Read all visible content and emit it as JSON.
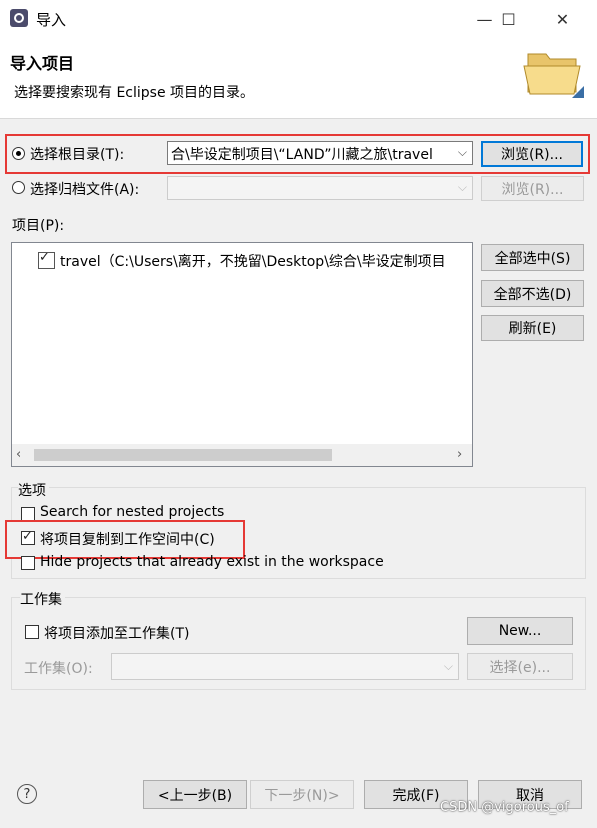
{
  "window": {
    "title": "导入",
    "controls": {
      "minimize": "—",
      "maximize": "☐",
      "close": "✕"
    }
  },
  "header": {
    "title": "导入项目",
    "subtitle": "选择要搜索现有 Eclipse 项目的目录。"
  },
  "source": {
    "root_dir_label": "选择根目录(T):",
    "root_dir_selected": true,
    "root_dir_value": "合\\毕设定制项目\\“LAND”川藏之旅\\travel",
    "root_browse_label": "浏览(R)...",
    "archive_label": "选择归档文件(A):",
    "archive_selected": false,
    "archive_value": "",
    "archive_browse_label": "浏览(R)..."
  },
  "projects": {
    "label": "项目(P):",
    "items": [
      {
        "checked": true,
        "text": "travel（C:\\Users\\离开，不挽留\\Desktop\\综合\\毕设定制项目"
      }
    ],
    "buttons": {
      "select_all": "全部选中(S)",
      "deselect_all": "全部不选(D)",
      "refresh": "刷新(E)"
    }
  },
  "options": {
    "group_label": "选项",
    "search_nested": {
      "label": "Search for nested projects",
      "checked": false
    },
    "copy_into_workspace": {
      "label": "将项目复制到工作空间中(C)",
      "checked": true
    },
    "hide_existing": {
      "label": "Hide projects that already exist in the workspace",
      "checked": false
    }
  },
  "working_sets": {
    "group_label": "工作集",
    "add_label": "将项目添加至工作集(T)",
    "add_checked": false,
    "new_label": "New...",
    "set_label": "工作集(O):",
    "set_value": "",
    "select_label": "选择(e)..."
  },
  "footer": {
    "help_icon": "?",
    "back": "<上一步(B)",
    "next": "下一步(N)>",
    "finish": "完成(F)",
    "cancel": "取消"
  },
  "watermark": "CSDN @vigorous_of",
  "colors": {
    "highlight_box": "#e53935",
    "primary_button_border": "#0078d7"
  }
}
